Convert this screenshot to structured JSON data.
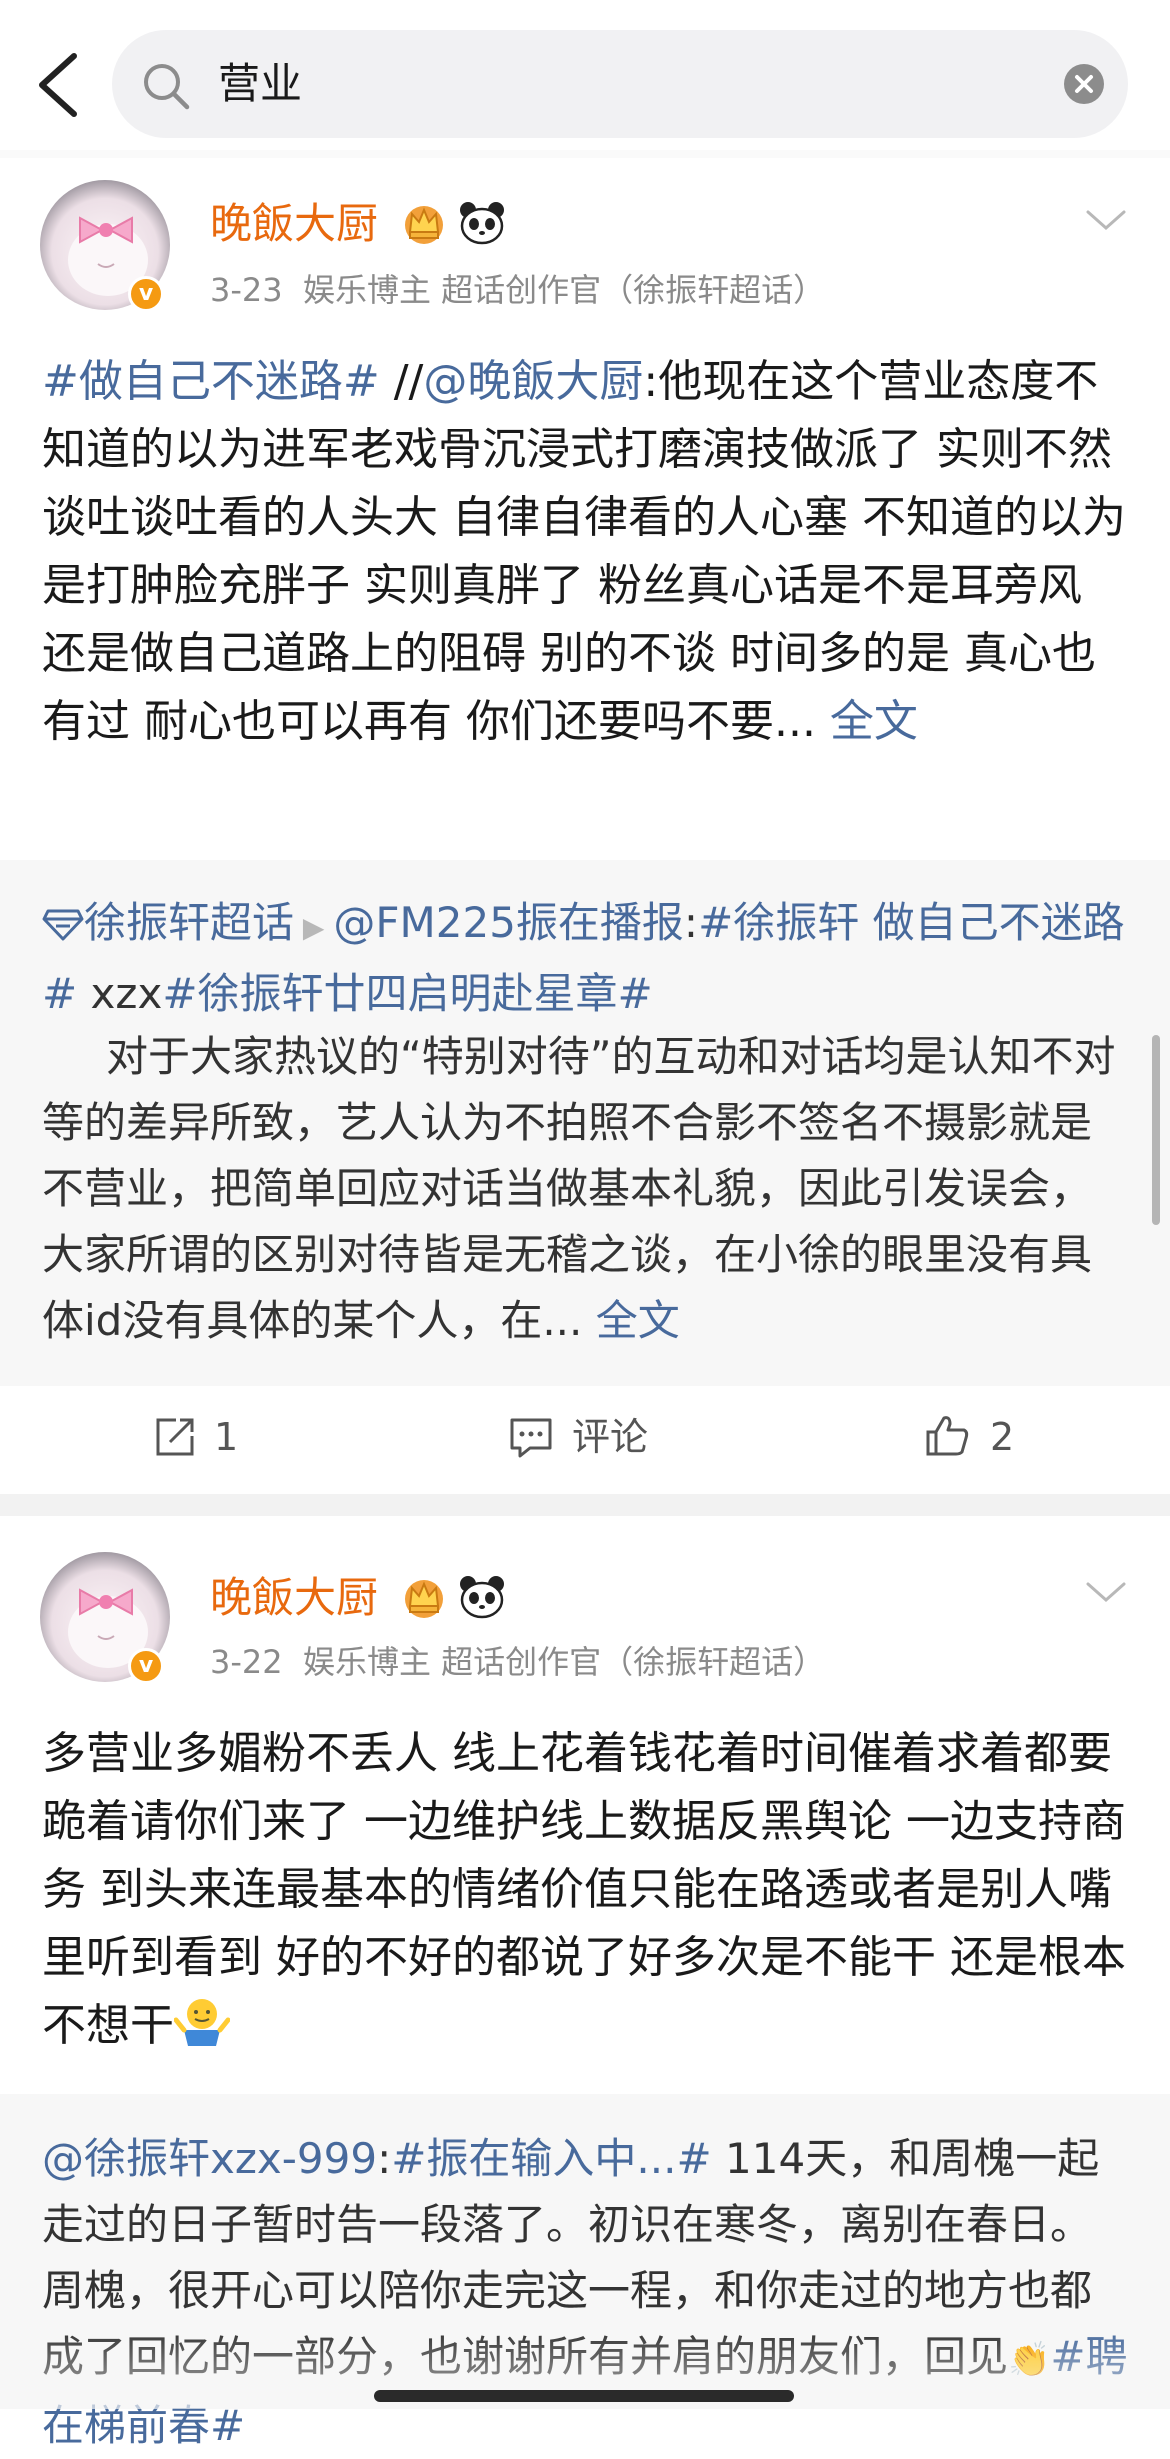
{
  "search": {
    "query": "营业"
  },
  "posts": [
    {
      "username": "晚飯大厨",
      "badges": [
        "crown-icon",
        "panda-icon"
      ],
      "date": "3-23",
      "tags_meta": "娱乐博主 超话创作官（徐振轩超话）",
      "text_segments": [
        {
          "text": "#做自己不迷路#",
          "link": true
        },
        {
          "text": " //",
          "link": false
        },
        {
          "text": "@晚飯大厨",
          "link": true
        },
        {
          "text": ":他现在这个营业态度不知道的以为进军老戏骨沉浸式打磨演技做派了 实则不然 谈吐谈吐看的人头大 自律自律看的人心塞 不知道的以为是打肿脸充胖子 实则真胖了 粉丝真心话是不是耳旁风 还是做自己道路上的阻碍 别的不谈 时间多的是 真心也有过 耐心也可以再有 你们还要吗不要...",
          "link": false
        },
        {
          "text": " 全文",
          "link": true
        }
      ],
      "quote": {
        "super_topic": "徐振轩超话",
        "head_segments": [
          {
            "text": "@FM225振在播报",
            "link": true
          },
          {
            "text": ":",
            "link": false
          },
          {
            "text": "#徐振轩 做自己不迷路#",
            "link": true
          },
          {
            "text": " xzx",
            "link": false
          },
          {
            "text": "#徐振轩廿四启明赴星章#",
            "link": true
          }
        ],
        "body": "对于大家热议的“特别对待”的互动和对话均是认知不对等的差异所致，艺人认为不拍照不合影不签名不摄影就是不营业，把简单回应对话当做基本礼貌，因此引发误会，大家所谓的区别对待皆是无稽之谈，在小徐的眼里没有具体id没有具体的某个人，在...",
        "more": " 全文"
      },
      "actions": {
        "repost": "1",
        "comment": "评论",
        "like": "2"
      }
    },
    {
      "username": "晚飯大厨",
      "badges": [
        "crown-icon",
        "panda-icon"
      ],
      "date": "3-22",
      "tags_meta": "娱乐博主 超话创作官（徐振轩超话）",
      "text": "多营业多媚粉不丢人 线上花着钱花着时间催着求着都要跪着请你们来了 一边维护线上数据反黑舆论 一边支持商务 到头来连最基本的情绪价值只能在路透或者是别人嘴里听到看到 好的不好的都说了好多次是不能干 还是根本不想干",
      "emoji": "shrug-icon",
      "quote": {
        "head_segments": [
          {
            "text": "@徐振轩xzx-999",
            "link": true
          },
          {
            "text": ":",
            "link": false
          },
          {
            "text": "#振在输入中...#",
            "link": true
          }
        ],
        "body": " 114天，和周槐一起走过的日子暂时告一段落了。初识在寒冬，离别在春日。周槐，很开心可以陪你走完这一程，和你走过的地方也都成了回忆的一部分，也谢谢所有并肩的朋友们，回见",
        "tail_tag": "#聘在梯前春#"
      }
    }
  ],
  "colors": {
    "link": "#486a9c",
    "username": "#e8690e",
    "meta": "#8a8a8a",
    "verified": "#f59a12"
  }
}
